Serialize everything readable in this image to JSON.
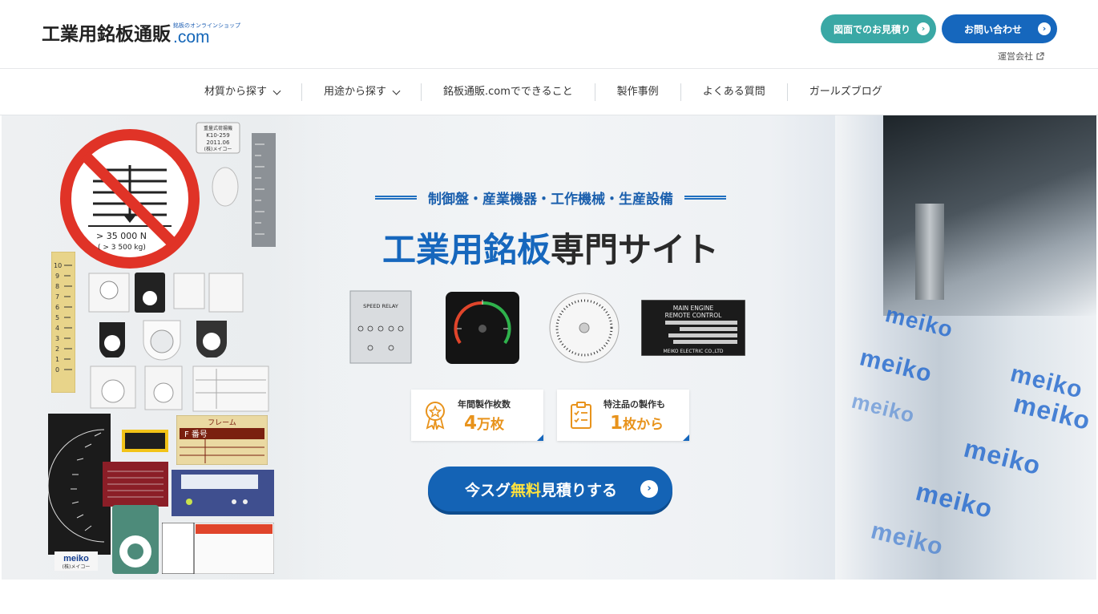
{
  "header": {
    "logo_main": "工業用銘板通販",
    "logo_sub": "銘板のオンラインショップ",
    "logo_com": ".com",
    "quote_button": "図面でのお見積り",
    "contact_button": "お問い合わせ",
    "company_link": "運営会社"
  },
  "nav": {
    "items": [
      {
        "label": "材質から探す"
      },
      {
        "label": "用途から探す"
      },
      {
        "label": "銘板通販.comでできること"
      },
      {
        "label": "製作事例"
      },
      {
        "label": "よくある質問"
      },
      {
        "label": "ガールズブログ"
      }
    ]
  },
  "hero": {
    "tagline": "制御盤・産業機器・工作機械・生産設備",
    "title_blue": "工業用銘板",
    "title_dark": "専門サイト",
    "badge1": {
      "label": "年間製作枚数",
      "value": "4",
      "unit": "万枚"
    },
    "badge2": {
      "label": "特注品の製作も",
      "value": "1",
      "unit": "枚から"
    },
    "cta": {
      "part1": "今スグ",
      "part2": "無料",
      "part3": "見積りする"
    },
    "plates": {
      "speed_relay": "SPEED RELAY",
      "engine_title1": "MAIN ENGINE",
      "engine_title2": "REMOTE CONTROL",
      "engine_maker": "MEIKO ELECTRIC CO.,LTD",
      "sign_text1": "> 35 000 N",
      "sign_text2": "( > 3 500 kg)",
      "frame_label": "フレーム",
      "frame_number": "F 番号",
      "meiko_logo": "meiko",
      "meiko_sub": "(株)メイコー",
      "top_plate1": "重量式荷揚機",
      "top_plate2": "K10-259",
      "top_plate3": "2011.06",
      "top_plate4": "(株)メイコー"
    },
    "brand_word": "meiko"
  },
  "colors": {
    "teal": "#3aa8a5",
    "blue": "#1667bd",
    "orange": "#e8931c",
    "yellow": "#ffe23d"
  }
}
